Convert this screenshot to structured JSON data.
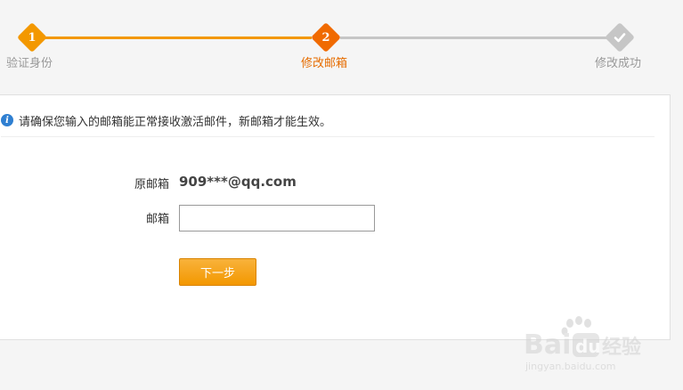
{
  "stepper": {
    "steps": [
      {
        "number": "1",
        "label": "验证身份",
        "state": "done"
      },
      {
        "number": "2",
        "label": "修改邮箱",
        "state": "current"
      },
      {
        "number": "",
        "label": "修改成功",
        "state": "todo"
      }
    ],
    "colors": {
      "done": "#f39800",
      "current": "#f06a00",
      "todo": "#c6c6c6",
      "current_label": "#e66c00"
    }
  },
  "notice": {
    "icon": "info-icon",
    "text": "请确保您输入的邮箱能正常接收激活邮件，新邮箱才能生效。"
  },
  "form": {
    "original_email_label": "原邮箱",
    "original_email_value": "909***@qq.com",
    "email_label": "邮箱",
    "email_value": "",
    "email_placeholder": "",
    "next_button_label": "下一步"
  },
  "watermark": {
    "brand": "Baidu经验",
    "url": "jingyan.baidu.com"
  }
}
